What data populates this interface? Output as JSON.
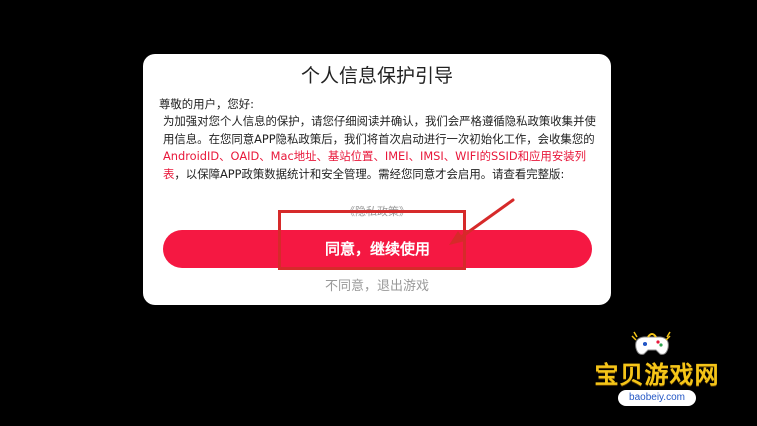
{
  "dialog": {
    "title": "个人信息保护引导",
    "greeting": "尊敬的用户，您好:",
    "body": {
      "p1": " 为加强对您个人信息的保护，请您仔细阅读并确认，我们会严格遵循隐私政策收集并使用信息。在您同意APP隐私政策后，我们将首次启动进行一次初始化工作，会收集您的",
      "highlight": "AndroidID、OAID、Mac地址、基站位置、IMEI、IMSI、WIFI的SSID和应用安装列表",
      "p2": "，以保障APP政策数据统计和安全管理。需经您同意才会启用。请查看完整版:"
    },
    "policy_link": "《隐私政策》",
    "agree_label": "同意，继续使用",
    "decline_label": "不同意，退出游戏"
  },
  "watermark": {
    "brand": "宝贝游戏网",
    "url": "baobeiy.com"
  },
  "colors": {
    "background": "#000000",
    "dialog_bg": "#ffffff",
    "accent": "#f51842",
    "highlight_text": "#e8173a",
    "annotation": "#d62a2a",
    "muted": "#999999"
  }
}
